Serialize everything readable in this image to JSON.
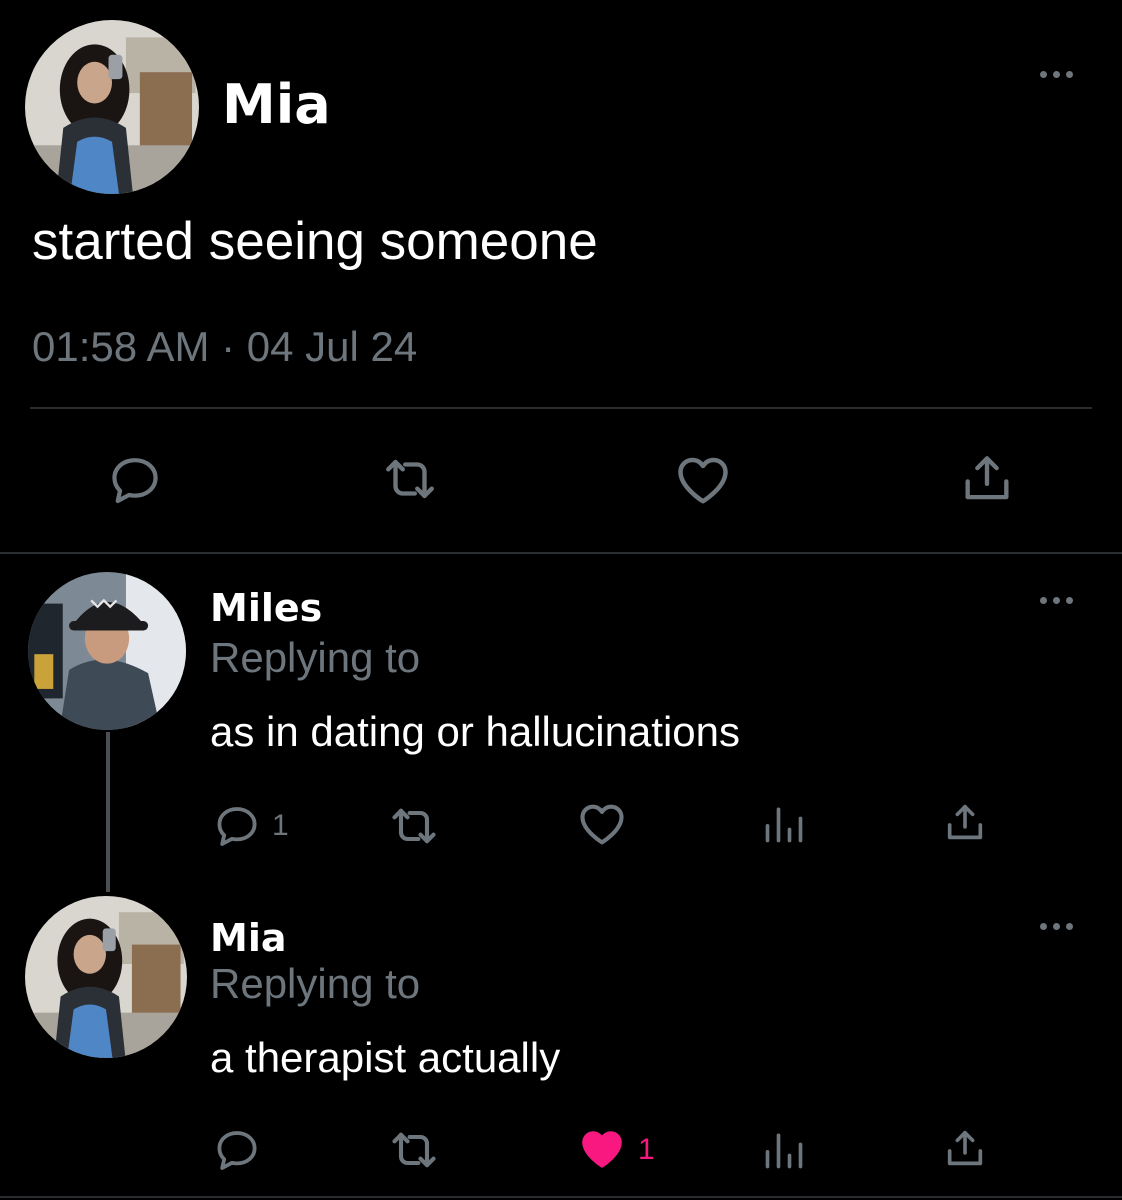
{
  "main_post": {
    "author": "Mia",
    "text": "started seeing someone",
    "timestamp": "01:58 AM · 04 Jul 24",
    "actions": [
      "reply-icon",
      "retweet-icon",
      "like-icon",
      "share-icon"
    ]
  },
  "replies": [
    {
      "author": "Miles",
      "replying_label": "Replying to",
      "text": "as in dating or hallucinations",
      "reply_count": "1",
      "like_count": "",
      "liked": false
    },
    {
      "author": "Mia",
      "replying_label": "Replying to",
      "text": "a therapist actually",
      "reply_count": "",
      "like_count": "1",
      "liked": true
    }
  ],
  "colors": {
    "background": "#000000",
    "text": "#ffffff",
    "muted": "#6e767d",
    "like_active": "#f91880",
    "divider": "#2a2d30",
    "thread_line": "#4a4e52"
  }
}
